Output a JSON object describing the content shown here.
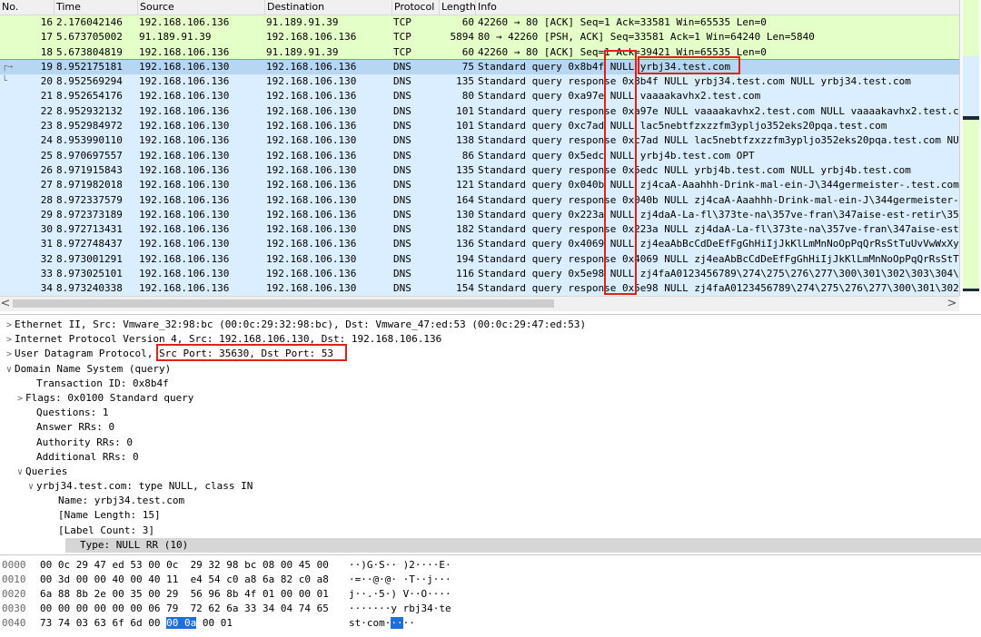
{
  "packet_list": {
    "columns": [
      "No.",
      "Time",
      "Source",
      "Destination",
      "Protocol",
      "Length",
      "Info"
    ],
    "rows": [
      {
        "no": "16",
        "time": "2.176042146",
        "src": "192.168.106.136",
        "dst": "91.189.91.39",
        "proto": "TCP",
        "len": "60",
        "info": "42260 → 80 [ACK] Seq=1 Ack=33581 Win=65535 Len=0"
      },
      {
        "no": "17",
        "time": "5.673705002",
        "src": "91.189.91.39",
        "dst": "192.168.106.136",
        "proto": "TCP",
        "len": "5894",
        "info": "80 → 42260 [PSH, ACK] Seq=33581 Ack=1 Win=64240 Len=5840"
      },
      {
        "no": "18",
        "time": "5.673804819",
        "src": "192.168.106.136",
        "dst": "91.189.91.39",
        "proto": "TCP",
        "len": "60",
        "info": "42260 → 80 [ACK] Seq=1 Ack=39421 Win=65535 Len=0"
      },
      {
        "no": "19",
        "time": "8.952175181",
        "src": "192.168.106.130",
        "dst": "192.168.106.136",
        "proto": "DNS",
        "len": "75",
        "info": "Standard query 0x8b4f NULL yrbj34.test.com"
      },
      {
        "no": "20",
        "time": "8.952569294",
        "src": "192.168.106.136",
        "dst": "192.168.106.130",
        "proto": "DNS",
        "len": "135",
        "info": "Standard query response 0x8b4f NULL yrbj34.test.com NULL yrbj34.test.com"
      },
      {
        "no": "21",
        "time": "8.952654176",
        "src": "192.168.106.130",
        "dst": "192.168.106.136",
        "proto": "DNS",
        "len": "80",
        "info": "Standard query 0xa97e NULL vaaaakavhx2.test.com"
      },
      {
        "no": "22",
        "time": "8.952932132",
        "src": "192.168.106.136",
        "dst": "192.168.106.130",
        "proto": "DNS",
        "len": "101",
        "info": "Standard query response 0xa97e NULL vaaaakavhx2.test.com NULL vaaaakavhx2.test.c"
      },
      {
        "no": "23",
        "time": "8.952984972",
        "src": "192.168.106.130",
        "dst": "192.168.106.136",
        "proto": "DNS",
        "len": "101",
        "info": "Standard query 0xc7ad NULL lac5nebtfzxzzfm3ypljo352eks20pqa.test.com"
      },
      {
        "no": "24",
        "time": "8.953990110",
        "src": "192.168.106.136",
        "dst": "192.168.106.130",
        "proto": "DNS",
        "len": "138",
        "info": "Standard query response 0xc7ad NULL lac5nebtfzxzzfm3ypljo352eks20pqa.test.com NU"
      },
      {
        "no": "25",
        "time": "8.970697557",
        "src": "192.168.106.130",
        "dst": "192.168.106.136",
        "proto": "DNS",
        "len": "86",
        "info": "Standard query 0x5edc NULL yrbj4b.test.com OPT"
      },
      {
        "no": "26",
        "time": "8.971915843",
        "src": "192.168.106.136",
        "dst": "192.168.106.130",
        "proto": "DNS",
        "len": "135",
        "info": "Standard query response 0x5edc NULL yrbj4b.test.com NULL yrbj4b.test.com"
      },
      {
        "no": "27",
        "time": "8.971982018",
        "src": "192.168.106.130",
        "dst": "192.168.106.136",
        "proto": "DNS",
        "len": "121",
        "info": "Standard query 0x040b NULL zj4caA-Aaahhh-Drink-mal-ein-J\\344germeister-.test.com"
      },
      {
        "no": "28",
        "time": "8.972337579",
        "src": "192.168.106.136",
        "dst": "192.168.106.130",
        "proto": "DNS",
        "len": "164",
        "info": "Standard query response 0x040b NULL zj4caA-Aaahhh-Drink-mal-ein-J\\344germeister-"
      },
      {
        "no": "29",
        "time": "8.972373189",
        "src": "192.168.106.130",
        "dst": "192.168.106.136",
        "proto": "DNS",
        "len": "130",
        "info": "Standard query 0x223a NULL zj4daA-La-fl\\373te-na\\357ve-fran\\347aise-est-retir\\35"
      },
      {
        "no": "30",
        "time": "8.972713431",
        "src": "192.168.106.136",
        "dst": "192.168.106.130",
        "proto": "DNS",
        "len": "182",
        "info": "Standard query response 0x223a NULL zj4daA-La-fl\\373te-na\\357ve-fran\\347aise-est"
      },
      {
        "no": "31",
        "time": "8.972748437",
        "src": "192.168.106.130",
        "dst": "192.168.106.136",
        "proto": "DNS",
        "len": "136",
        "info": "Standard query 0x4069 NULL zj4eaAbBcCdDeEfFgGhHiIjJkKlLmMnNoOpPqQrRsStTuUvVwWxXy"
      },
      {
        "no": "32",
        "time": "8.973001291",
        "src": "192.168.106.136",
        "dst": "192.168.106.130",
        "proto": "DNS",
        "len": "194",
        "info": "Standard query response 0x4069 NULL zj4eaAbBcCdDeEfFgGhHiIjJkKlLmMnNoOpPqQrRsStT"
      },
      {
        "no": "33",
        "time": "8.973025101",
        "src": "192.168.106.130",
        "dst": "192.168.106.136",
        "proto": "DNS",
        "len": "116",
        "info": "Standard query 0x5e98 NULL zj4faA0123456789\\274\\275\\276\\277\\300\\301\\302\\303\\304\\"
      },
      {
        "no": "34",
        "time": "8.973240338",
        "src": "192.168.106.136",
        "dst": "192.168.106.130",
        "proto": "DNS",
        "len": "154",
        "info": "Standard query response 0x5e98 NULL zj4faA0123456789\\274\\275\\276\\277\\300\\301\\302"
      }
    ],
    "selected_no": "19",
    "scroll_left": "<",
    "scroll_right": ">"
  },
  "detail": {
    "lines": [
      {
        "toggle": ">",
        "text": "Ethernet II, Src: Vmware_32:98:bc (00:0c:29:32:98:bc), Dst: Vmware_47:ed:53 (00:0c:29:47:ed:53)",
        "indent": 0
      },
      {
        "toggle": ">",
        "text": "Internet Protocol Version 4, Src: 192.168.106.130, Dst: 192.168.106.136",
        "indent": 0
      },
      {
        "toggle": ">",
        "text": "User Datagram Protocol, ",
        "highlight": "Src Port: 35630, Dst Port: 53",
        "indent": 0
      },
      {
        "toggle": "∨",
        "text": "Domain Name System (query)",
        "indent": 0
      },
      {
        "toggle": "",
        "text": "Transaction ID: 0x8b4f",
        "indent": 2
      },
      {
        "toggle": ">",
        "text": "Flags: 0x0100 Standard query",
        "indent": 1
      },
      {
        "toggle": "",
        "text": "Questions: 1",
        "indent": 2
      },
      {
        "toggle": "",
        "text": "Answer RRs: 0",
        "indent": 2
      },
      {
        "toggle": "",
        "text": "Authority RRs: 0",
        "indent": 2
      },
      {
        "toggle": "",
        "text": "Additional RRs: 0",
        "indent": 2
      },
      {
        "toggle": "∨",
        "text": "Queries",
        "indent": 1
      },
      {
        "toggle": "∨",
        "text": "yrbj34.test.com: type NULL, class IN",
        "indent": 2
      },
      {
        "toggle": "",
        "text": "Name: yrbj34.test.com",
        "indent": 4
      },
      {
        "toggle": "",
        "text": "[Name Length: 15]",
        "indent": 4
      },
      {
        "toggle": "",
        "text": "[Label Count: 3]",
        "indent": 4
      },
      {
        "toggle": "",
        "text": "Type: NULL RR (10)",
        "indent": 4,
        "selected": true
      }
    ]
  },
  "bytes": {
    "lines": [
      {
        "off": "0000",
        "hex": "00 0c 29 47 ed 53 00 0c  29 32 98 bc 08 00 45 00",
        "ascii": "··)G·S·· )2····E·"
      },
      {
        "off": "0010",
        "hex": "00 3d 00 00 40 00 40 11  e4 54 c0 a8 6a 82 c0 a8",
        "ascii": "·=··@·@· ·T··j···"
      },
      {
        "off": "0020",
        "hex": "6a 88 8b 2e 00 35 00 29  56 96 8b 4f 01 00 00 01",
        "ascii": "j··.·5·) V··O····"
      },
      {
        "off": "0030",
        "hex": "00 00 00 00 00 00 06 79  72 62 6a 33 34 04 74 65",
        "ascii": "·······y rbj34·te"
      },
      {
        "off": "0040",
        "hex_pre": "73 74 03 63 6f 6d 00 ",
        "hex_sel": "00 0a",
        "hex_post": " 00 01",
        "ascii_pre": "st·com·",
        "ascii_sel": "··",
        "ascii_post": "··"
      }
    ]
  },
  "colors": {
    "tcp_row": "#e4ffc7",
    "dns_row": "#daeeff",
    "selected_row": "#b6d6f2",
    "annotation": "#e0201a",
    "byte_selection": "#1e6fd9"
  }
}
